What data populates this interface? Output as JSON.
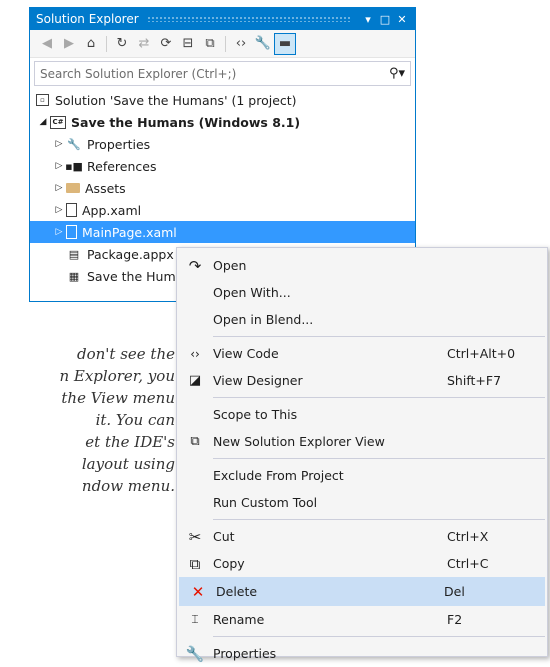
{
  "solution_explorer": {
    "title": "Solution Explorer",
    "title_buttons": [
      "▾",
      "□",
      "✕"
    ],
    "search_placeholder": "Search Solution Explorer (Ctrl+;)",
    "tree": {
      "solution": "Solution 'Save the Humans' (1 project)",
      "project": "Save the Humans (Windows 8.1)",
      "properties": "Properties",
      "references": "References",
      "assets": "Assets",
      "app_xaml": "App.xaml",
      "mainpage": "MainPage.xaml",
      "package": "Package.appx",
      "save_the_hum": "Save the Hum"
    }
  },
  "note": {
    "lines": [
      "don't see the",
      "n Explorer, you",
      "the View menu",
      "it. You can",
      "et the IDE's",
      "layout using",
      "ndow menu."
    ]
  },
  "context_menu": {
    "items": {
      "open": {
        "label": "Open",
        "shortcut": ""
      },
      "open_with": {
        "label": "Open With...",
        "shortcut": ""
      },
      "open_blend": {
        "label": "Open in Blend...",
        "shortcut": ""
      },
      "view_code": {
        "label": "View Code",
        "shortcut": "Ctrl+Alt+0"
      },
      "view_designer": {
        "label": "View Designer",
        "shortcut": "Shift+F7"
      },
      "scope": {
        "label": "Scope to This",
        "shortcut": ""
      },
      "new_view": {
        "label": "New Solution Explorer View",
        "shortcut": ""
      },
      "exclude": {
        "label": "Exclude From Project",
        "shortcut": ""
      },
      "run_tool": {
        "label": "Run Custom Tool",
        "shortcut": ""
      },
      "cut": {
        "label": "Cut",
        "shortcut": "Ctrl+X"
      },
      "copy": {
        "label": "Copy",
        "shortcut": "Ctrl+C"
      },
      "delete": {
        "label": "Delete",
        "shortcut": "Del"
      },
      "rename": {
        "label": "Rename",
        "shortcut": "F2"
      },
      "properties": {
        "label": "Properties",
        "shortcut": ""
      }
    },
    "highlighted": "Delete"
  },
  "colors": {
    "accent": "#007acc",
    "selection": "#3399ff",
    "menu_highlight": "#c9def5",
    "delete_icon": "#e51400"
  }
}
